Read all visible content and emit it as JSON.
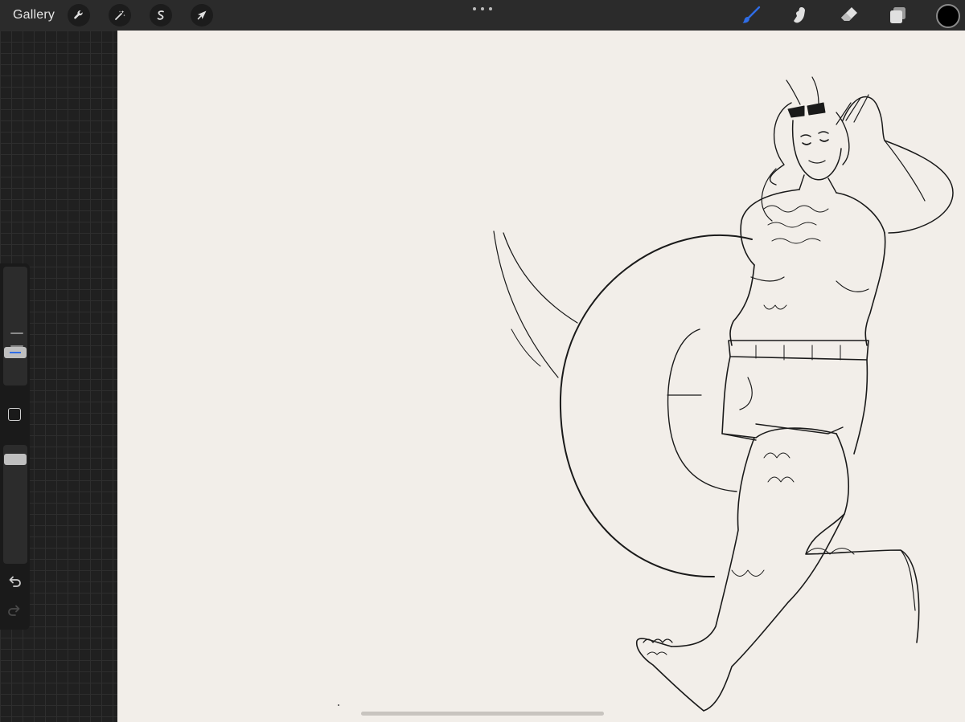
{
  "toolbar": {
    "gallery_label": "Gallery",
    "left_tools": [
      {
        "name": "actions",
        "icon": "wrench-icon"
      },
      {
        "name": "adjustments",
        "icon": "magic-wand-icon"
      },
      {
        "name": "selection",
        "icon": "selection-s-icon"
      },
      {
        "name": "transform",
        "icon": "arrow-cursor-icon"
      }
    ],
    "more_icon": "ellipsis-icon",
    "right_tools": [
      {
        "name": "brush",
        "icon": "brush-icon",
        "active": true,
        "color": "#2f6de6"
      },
      {
        "name": "smudge",
        "icon": "smudge-finger-icon",
        "active": false
      },
      {
        "name": "eraser",
        "icon": "eraser-icon",
        "active": false
      },
      {
        "name": "layers",
        "icon": "layers-icon",
        "active": false
      }
    ],
    "current_color": "#000000"
  },
  "sidebar": {
    "brush_size_slider": {
      "level": 0.25
    },
    "opacity_slider": {
      "level": 0.1
    },
    "modify_button_icon": "square-icon",
    "undo_icon": "undo-icon",
    "redo_icon": "redo-icon"
  },
  "canvas": {
    "background_color": "#f2eee9",
    "line_color": "#1a1a1a"
  }
}
